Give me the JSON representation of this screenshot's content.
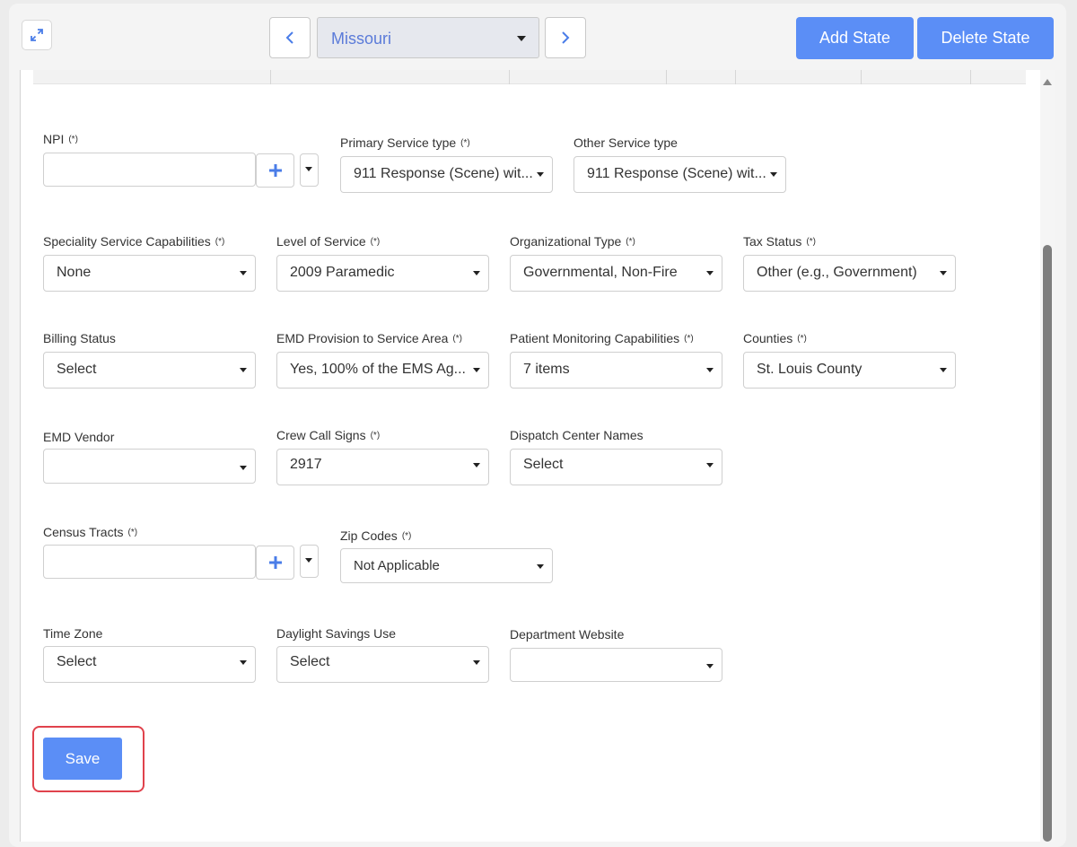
{
  "header": {
    "state_value": "Missouri",
    "add_state_label": "Add State",
    "delete_state_label": "Delete State"
  },
  "form": {
    "npi": {
      "label": "NPI",
      "req": "(*)",
      "value": ""
    },
    "primary_service_type": {
      "label": "Primary Service type",
      "req": "(*)",
      "value": "911 Response (Scene) wit..."
    },
    "other_service_type": {
      "label": "Other Service type",
      "value": "911 Response (Scene) wit..."
    },
    "speciality": {
      "label": "Speciality Service Capabilities",
      "req": "(*)",
      "value": "None"
    },
    "level_of_service": {
      "label": "Level of Service",
      "req": "(*)",
      "value": "2009 Paramedic"
    },
    "org_type": {
      "label": "Organizational Type",
      "req": "(*)",
      "value": "Governmental, Non-Fire"
    },
    "tax_status": {
      "label": "Tax Status",
      "req": "(*)",
      "value": "Other (e.g., Government)"
    },
    "billing_status": {
      "label": "Billing Status",
      "value": "Select"
    },
    "emd_provision": {
      "label": "EMD Provision to Service Area",
      "req": "(*)",
      "value": "Yes, 100% of the EMS Ag..."
    },
    "patient_monitoring": {
      "label": "Patient Monitoring Capabilities",
      "req": "(*)",
      "value": "7 items"
    },
    "counties": {
      "label": "Counties",
      "req": "(*)",
      "value": "St. Louis County"
    },
    "emd_vendor": {
      "label": "EMD Vendor",
      "value": ""
    },
    "crew_call_signs": {
      "label": "Crew Call Signs",
      "req": "(*)",
      "value": "2917"
    },
    "dispatch_center": {
      "label": "Dispatch Center Names",
      "value": "Select"
    },
    "census_tracts": {
      "label": "Census Tracts",
      "req": "(*)",
      "value": ""
    },
    "zip_codes": {
      "label": "Zip Codes",
      "req": "(*)",
      "value": "Not Applicable"
    },
    "time_zone": {
      "label": "Time Zone",
      "value": "Select"
    },
    "daylight_savings": {
      "label": "Daylight Savings Use",
      "value": "Select"
    },
    "dept_website": {
      "label": "Department Website",
      "value": ""
    }
  },
  "save_label": "Save",
  "colors": {
    "accent": "#5b8ef6",
    "highlight": "#e0424c",
    "state_text": "#5b7bd9"
  }
}
